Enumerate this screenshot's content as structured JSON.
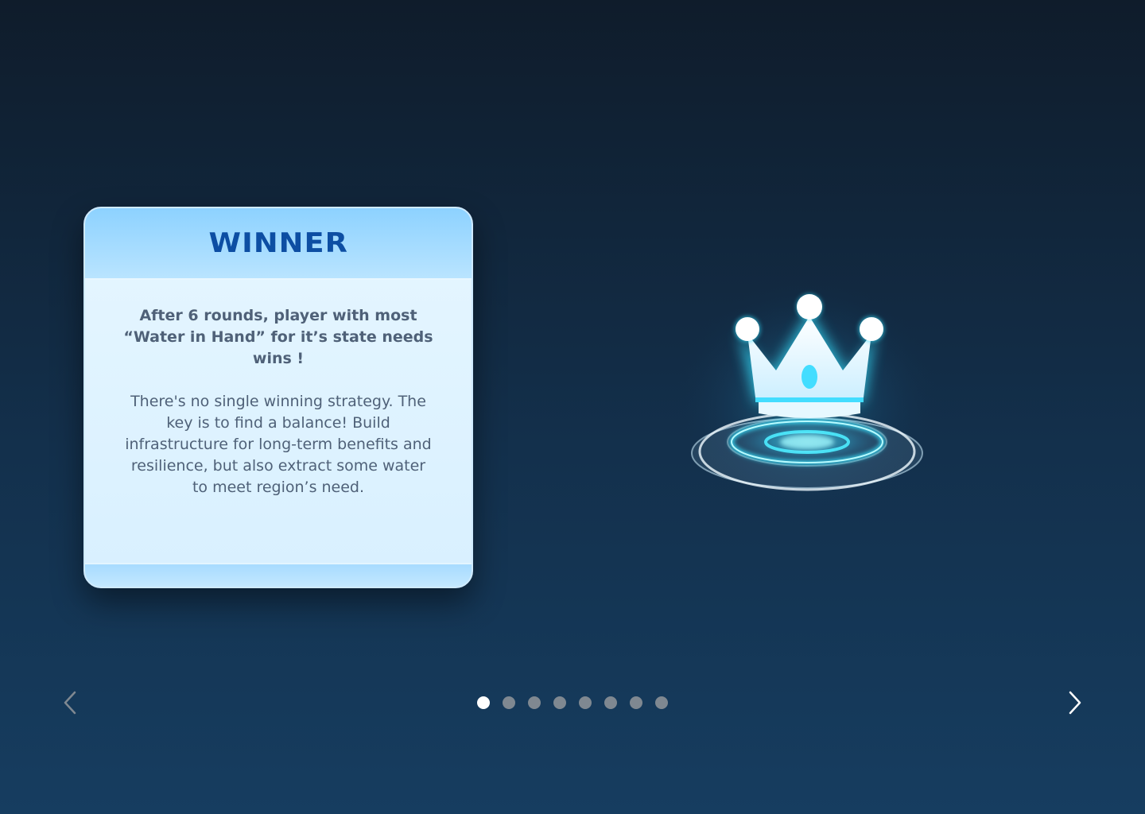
{
  "card": {
    "title": "WINNER",
    "paragraph_1": "After 6 rounds, player with most “Water in Hand” for it’s state needs wins !",
    "paragraph_2": "There's no single winning strategy. The key is to find a balance! Build infrastructure for long-term benefits and resilience, but also extract some water to meet region’s need."
  },
  "illustration": {
    "icon": "crown-on-glowing-pedestal-icon",
    "glow_color": "#3de6ff"
  },
  "pagination": {
    "total": 8,
    "current": 1
  },
  "navigation": {
    "prev_icon": "chevron-left-icon",
    "next_icon": "chevron-right-icon"
  },
  "colors": {
    "title": "#0d4ea3",
    "body_text": "#4f6178",
    "dot_active": "#ffffff",
    "dot_inactive": "#7f8891"
  }
}
